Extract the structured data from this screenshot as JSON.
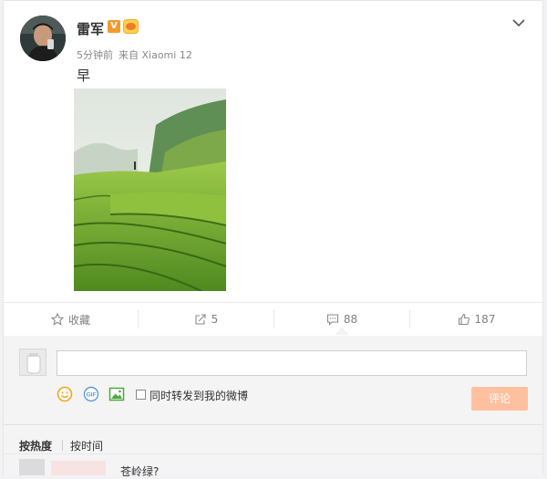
{
  "post": {
    "username": "雷军",
    "verified_badge": "V",
    "time": "5分钟前",
    "source": "来自 Xiaomi 12",
    "text": "早"
  },
  "icons": {
    "avatar": "user-avatar",
    "verified": "verified-icon",
    "member": "crown-icon",
    "menu": "chevron-down-icon",
    "favorite": "star-icon",
    "repost": "repost-icon",
    "comment": "comment-icon",
    "like": "thumbs-up-icon",
    "emoji": "emoji-icon",
    "gif": "gif-icon",
    "image": "image-icon"
  },
  "actions": {
    "favorite_label": "收藏",
    "repost_count": "5",
    "comment_count": "88",
    "like_count": "187"
  },
  "comment_box": {
    "input_value": "",
    "checkbox_label": "同时转发到我的微博",
    "submit_label": "评论",
    "gif_label": "GIF"
  },
  "sort": {
    "hot_label": "按热度",
    "time_label": "按时间"
  },
  "first_comment": {
    "text": "苍岭绿?"
  },
  "colors": {
    "accent_disabled": "#ffc09f",
    "badge_orange": "#f49a2a",
    "emoji_orange": "#f7a21b",
    "gif_blue": "#5a9ad8",
    "image_green": "#4aa83a"
  }
}
